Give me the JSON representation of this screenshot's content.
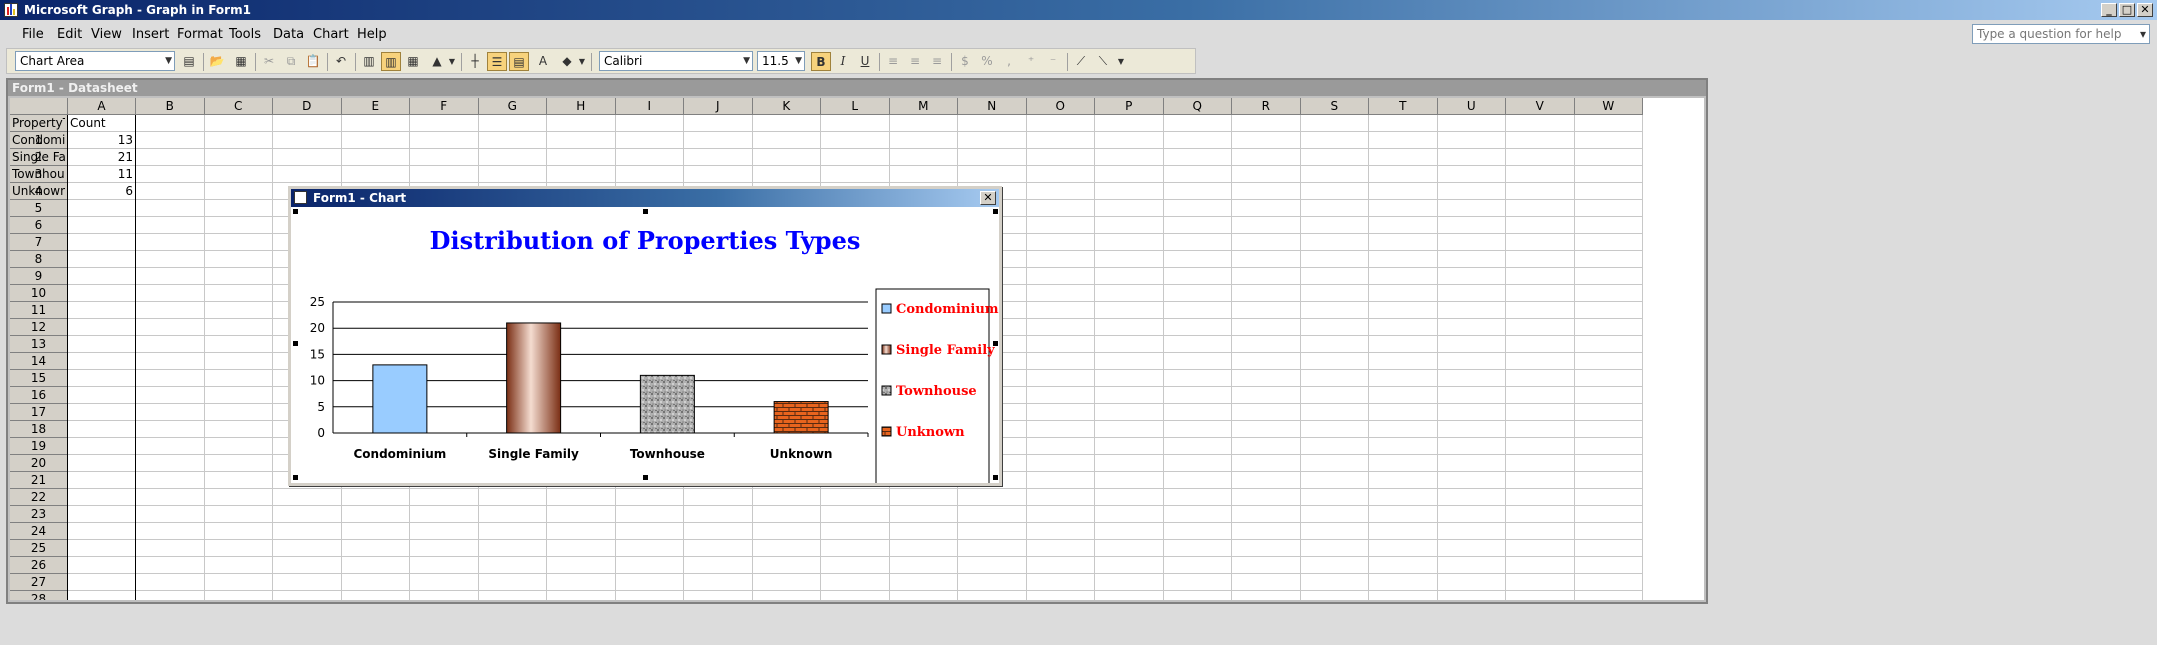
{
  "app": {
    "title": "Microsoft Graph - Graph in Form1",
    "window_buttons": [
      "_",
      "□",
      "✕"
    ]
  },
  "menus": [
    "File",
    "Edit",
    "View",
    "Insert",
    "Format",
    "Tools",
    "Data",
    "Chart",
    "Help"
  ],
  "help_box": {
    "placeholder": "Type a question for help"
  },
  "toolbar": {
    "chart_objects": "Chart Area",
    "font": "Calibri",
    "size": "11.5",
    "bold": "B",
    "italic": "I",
    "underline": "U",
    "currency": "$",
    "percent": "%"
  },
  "datasheet": {
    "title": "Form1 - Datasheet",
    "columns": [
      "A",
      "B",
      "C",
      "D",
      "E",
      "F",
      "G",
      "H",
      "I",
      "J",
      "K",
      "L",
      "M",
      "N",
      "O",
      "P",
      "Q",
      "R",
      "S",
      "T",
      "U",
      "V",
      "W"
    ],
    "row_numbers": [
      "1",
      "2",
      "3",
      "4",
      "5",
      "6",
      "7",
      "8",
      "9",
      "10",
      "11",
      "12",
      "13",
      "14",
      "15",
      "16",
      "17",
      "18",
      "19",
      "20",
      "21",
      "22",
      "23",
      "24",
      "25",
      "26",
      "27",
      "28"
    ],
    "header_row": [
      "PropertyTyp",
      "Count"
    ],
    "rows": [
      [
        "Condominiu",
        "13"
      ],
      [
        "Single Famil",
        "21"
      ],
      [
        "Townhouse",
        "11"
      ],
      [
        "Unknown",
        "6"
      ]
    ]
  },
  "chart_window": {
    "title": "Form1 - Chart",
    "close": "✕"
  },
  "chart_data": {
    "type": "bar",
    "title": "Distribution of Properties Types",
    "categories": [
      "Condominium",
      "Single Family",
      "Townhouse",
      "Unknown"
    ],
    "values": [
      13,
      21,
      11,
      6
    ],
    "xlabel": "",
    "ylabel": "",
    "ylim": [
      0,
      25
    ],
    "yticks": [
      "0",
      "5",
      "10",
      "15",
      "20",
      "25"
    ],
    "grid": true,
    "legend": {
      "position": "right",
      "entries": [
        "Condominium",
        "Single Family",
        "Townhouse",
        "Unknown"
      ]
    },
    "colors": {
      "title": "#0000ff",
      "legend_text": "#ff0000",
      "Condominium": "#99ccff",
      "Single Family": "#a0522d",
      "Townhouse": "#a8a8a8",
      "Unknown": "#e8641e"
    }
  }
}
